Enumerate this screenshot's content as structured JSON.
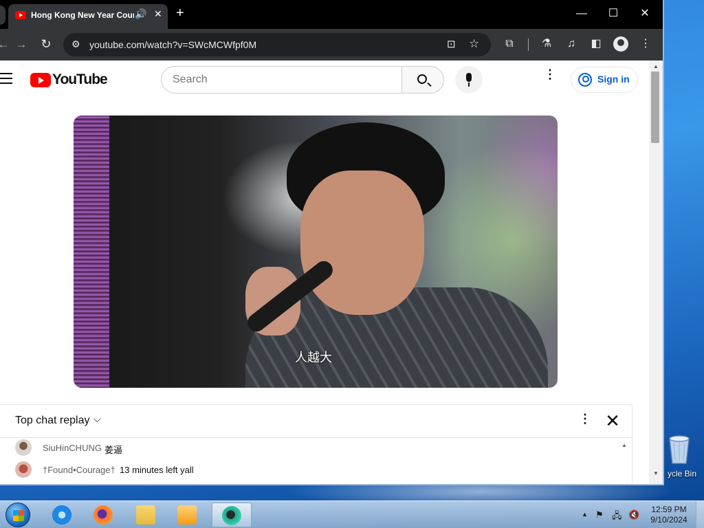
{
  "browser": {
    "tab_title": "Hong Kong New Year Cour",
    "tab_audio_glyph": "🔊",
    "tab_close_glyph": "✕",
    "new_tab_glyph": "+",
    "window": {
      "minimize_glyph": "—",
      "maximize_glyph": "☐",
      "close_glyph": "✕"
    },
    "url": "youtube.com/watch?v=SWcMCWfpf0M",
    "icons": {
      "back": "arrow-left-icon",
      "forward": "arrow-right-icon",
      "reload": "reload-icon",
      "site_info": "tune-icon",
      "install": "install-app-icon",
      "bookmark": "star-icon",
      "extensions": "puzzle-icon",
      "labs": "flask-icon",
      "media": "media-queue-icon",
      "side_panel": "side-panel-icon",
      "profile": "profile-icon",
      "menu": "kebab-icon"
    },
    "glyphs": {
      "back": "←",
      "forward": "→",
      "reload": "↻",
      "site_info": "⚙",
      "install": "⊡",
      "star": "☆",
      "extensions": "⧉",
      "labs": "⚗",
      "media": "♫",
      "side_panel": "◧",
      "menu": "⋮"
    }
  },
  "youtube": {
    "logo_text": "YouTube",
    "search_placeholder": "Search",
    "more_glyph": "⋮",
    "sign_in_label": "Sign in",
    "accent_color": "#065fd4",
    "brand_color": "#ff0000"
  },
  "video": {
    "subtitle": "人越大"
  },
  "chat": {
    "title": "Top chat replay",
    "chevron_glyph": "⌵",
    "more_glyph": "⋮",
    "close_glyph": "✕",
    "scroll_up_glyph": "▲",
    "messages": [
      {
        "author": "SiuHinCHUNG",
        "text": "姜逼"
      },
      {
        "author": "†Found•Courage†",
        "text": "13 minutes left yall"
      }
    ]
  },
  "desktop": {
    "recycle_bin_label": "ycle Bin"
  },
  "page_scrollbar": {
    "up_glyph": "▲",
    "down_glyph": "▼"
  },
  "taskbar": {
    "apps": [
      {
        "name": "internet-explorer-icon",
        "color": "#1e88e5"
      },
      {
        "name": "firefox-icon",
        "color": "#ff7139"
      },
      {
        "name": "file-explorer-icon",
        "color": "#f2c94c"
      },
      {
        "name": "media-player-icon",
        "color": "#f39c12"
      },
      {
        "name": "chrome-app-icon",
        "color": "#1faa8a"
      }
    ],
    "tray_arrow_glyph": "▲",
    "tray": {
      "flag": "⚑",
      "network": "🖧",
      "volume": "🔇"
    },
    "time": "12:59 PM",
    "date": "9/10/2024"
  }
}
